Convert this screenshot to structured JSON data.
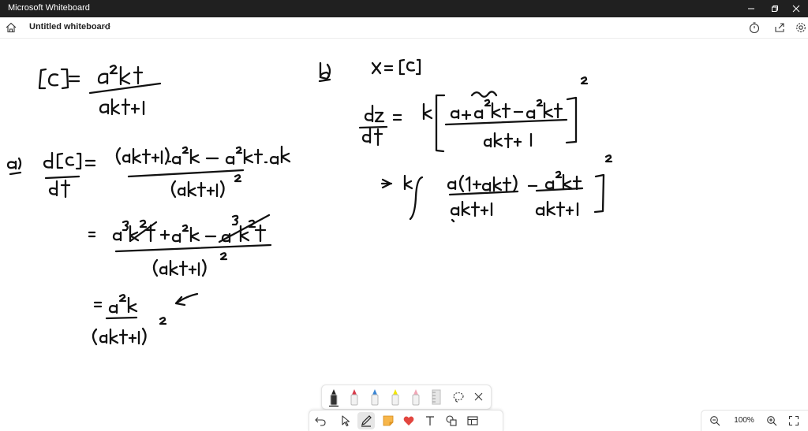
{
  "window": {
    "title": "Microsoft Whiteboard"
  },
  "appbar": {
    "board_name": "Untitled whiteboard"
  },
  "zoom": {
    "level": "100%"
  },
  "palette": {
    "pens": [
      {
        "name": "black-pen",
        "color": "#222222",
        "selected": true
      },
      {
        "name": "red-pen",
        "color": "#d83b4a"
      },
      {
        "name": "blue-pen",
        "color": "#3a86d4"
      },
      {
        "name": "highlighter-yellow",
        "color": "#f2e600"
      },
      {
        "name": "eraser-pink",
        "color": "#f0a6b6"
      },
      {
        "name": "ruler",
        "color": "#bdbdbd"
      }
    ]
  },
  "toolbar": {
    "tools": [
      "undo-icon",
      "select-icon",
      "pen-icon",
      "sticky-note-icon",
      "reaction-heart-icon",
      "text-icon",
      "shapes-icon",
      "templates-icon"
    ]
  },
  "canvas": {
    "ink_color": "#111111",
    "equations": {
      "definition": "[C] = a²kt / (akt+1)",
      "part_a_label": "a)",
      "part_a_line1": "d[C]/dt = ((akt+1).a²k − a²kt.ak) / (akt+1)²",
      "part_a_line2": "= (a³k²t + a²k − a³k²t) / (akt+1)²",
      "part_a_line3": "= a²k / (akt+1)²",
      "part_b_label": "b)",
      "part_b_line0": "x = [C]",
      "part_b_line1": "dx/dt = k[(a + a²kt − a²kt)/(akt+1)]²",
      "part_b_line2": "⇒ k[ a(1+akt)/(akt+1) − a²kt/(akt+1) ]²"
    }
  }
}
